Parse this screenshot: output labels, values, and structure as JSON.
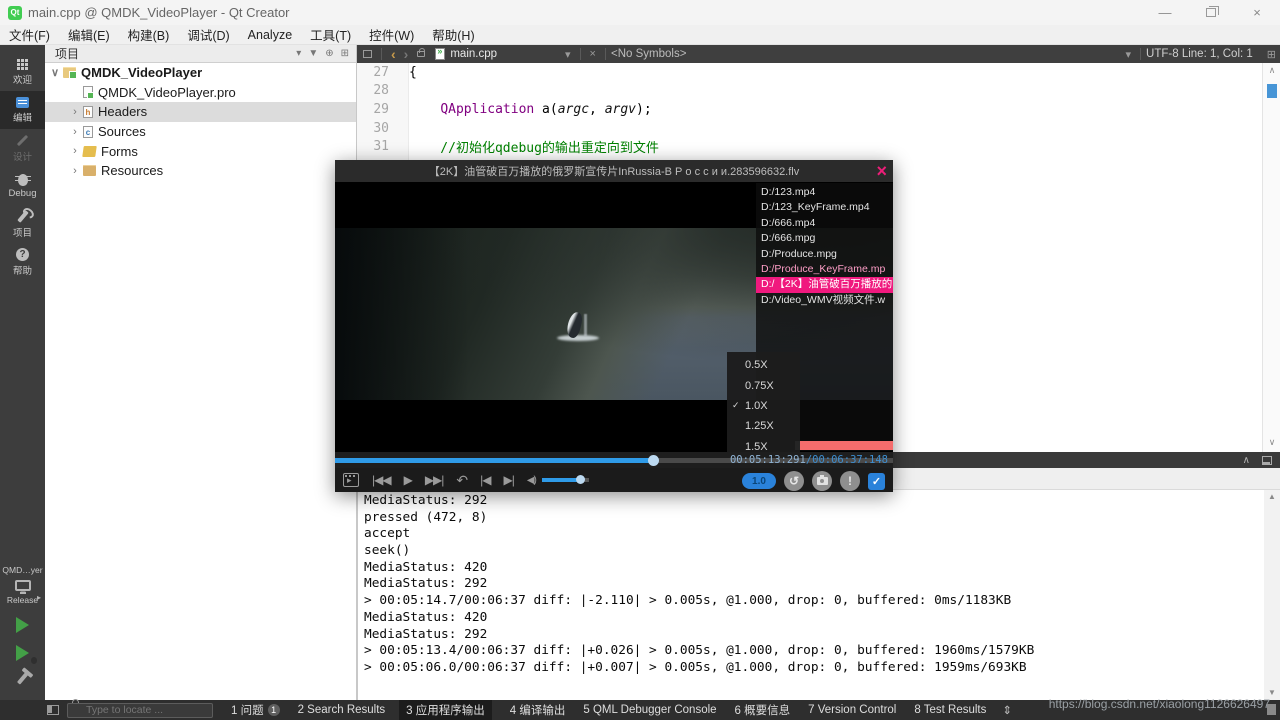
{
  "window": {
    "title": "main.cpp @ QMDK_VideoPlayer - Qt Creator",
    "app_badge": "Qt"
  },
  "menu": {
    "items": [
      {
        "label": "文件(F)"
      },
      {
        "label": "编辑(E)"
      },
      {
        "label": "构建(B)"
      },
      {
        "label": "调试(D)"
      },
      {
        "label": "Analyze"
      },
      {
        "label": "工具(T)"
      },
      {
        "label": "控件(W)"
      },
      {
        "label": "帮助(H)"
      }
    ]
  },
  "toolbar": {
    "panel_title": "项目",
    "open_file": "main.cpp",
    "symbols": "<No Symbols>",
    "cursor_info": "UTF-8 Line: 1, Col: 1"
  },
  "sidebar": {
    "modes": [
      {
        "label": "欢迎"
      },
      {
        "label": "编辑"
      },
      {
        "label": "设计"
      },
      {
        "label": "Debug"
      },
      {
        "label": "项目"
      },
      {
        "label": "帮助"
      }
    ],
    "target": "QMD…yer",
    "config": "Release"
  },
  "project_tree": {
    "items": [
      {
        "label": "QMDK_VideoPlayer"
      },
      {
        "label": "QMDK_VideoPlayer.pro"
      },
      {
        "label": "Headers"
      },
      {
        "label": "Sources"
      },
      {
        "label": "Forms"
      },
      {
        "label": "Resources"
      }
    ]
  },
  "editor": {
    "lines": [
      {
        "no": "27",
        "code": "{"
      },
      {
        "no": "28",
        "code": ""
      },
      {
        "no": "29",
        "seg": {
          "indent": "    ",
          "type": "QApplication",
          "p1": " a(",
          "arg1": "argc",
          "p2": ", ",
          "arg2": "argv",
          "p3": ");"
        }
      },
      {
        "no": "30",
        "code": ""
      },
      {
        "no": "31",
        "comment": "    //初始化qdebug的输出重定向到文件"
      }
    ]
  },
  "player": {
    "title": "【2K】油管破百万播放的俄罗斯宣传片InRussia-В Р о с с и и.283596632.flv",
    "playlist": [
      "D:/123.mp4",
      "D:/123_KeyFrame.mp4",
      "D:/666.mp4",
      "D:/666.mpg",
      "D:/Produce.mpg",
      "D:/Produce_KeyFrame.mp",
      "D:/【2K】油管破百万播放的",
      "D:/Video_WMV视频文件.w"
    ],
    "speed_menu": {
      "options": [
        "0.5X",
        "0.75X",
        "1.0X",
        "1.25X",
        "1.5X"
      ],
      "selected": "1.0X"
    },
    "time": {
      "current": "00:05:13:291",
      "separator": "/",
      "total": "00:06:37:148"
    },
    "progress_percent": 57,
    "volume_percent": 80,
    "speed_badge": "1.0"
  },
  "output": {
    "lines": [
      "MediaStatus: 292",
      "pressed (472, 8)",
      "accept",
      "seek()",
      "MediaStatus: 420",
      "MediaStatus: 292",
      "> 00:05:14.7/00:06:37 diff: |-2.110| > 0.005s, @1.000, drop: 0, buffered: 0ms/1183KB",
      "MediaStatus: 420",
      "MediaStatus: 292",
      "> 00:05:13.4/00:06:37 diff: |+0.026| > 0.005s, @1.000, drop: 0, buffered: 1960ms/1579KB",
      "> 00:05:06.0/00:06:37 diff: |+0.007| > 0.005s, @1.000, drop: 0, buffered: 1959ms/693KB"
    ]
  },
  "status_bar": {
    "locator_placeholder": "Type to locate ...",
    "tabs": [
      {
        "label": "1 问题",
        "badge": "1"
      },
      {
        "label": "2 Search Results"
      },
      {
        "label": "3 应用程序输出"
      },
      {
        "label": "4 编译输出"
      },
      {
        "label": "5 QML Debugger Console"
      },
      {
        "label": "6 概要信息"
      },
      {
        "label": "7 Version Control"
      },
      {
        "label": "8 Test Results"
      }
    ]
  },
  "watermark": "https://blog.csdn.net/xiaolong1126626497",
  "icons": {
    "dropdown": "▾",
    "back": "‹",
    "forward": "›",
    "close": "×",
    "split": "⊞",
    "filter": "▼",
    "sync": "⊕",
    "collapse": "∧",
    "expand": "∨",
    "check": "✓",
    "minimize": "—",
    "updown": "⇕",
    "prev": "|◀◀",
    "play": "▶",
    "next": "▶▶|",
    "undo": "↶",
    "step_back": "|◀",
    "step_fwd": "▶|",
    "rotate": "↺",
    "exclaim": "!",
    "speaker": "◀)",
    "chevron_expanded": "∨",
    "chevron_collapsed": "›",
    "up": "▲",
    "down": "▼"
  },
  "colors": {
    "accent_blue": "#2a82da",
    "seek_blue": "#2f9be8",
    "pink": "#ed1e79",
    "playlist_selected": "#f0197e",
    "red_bar": "#f56c6c",
    "keyword": "#800080",
    "comment": "#008000"
  }
}
